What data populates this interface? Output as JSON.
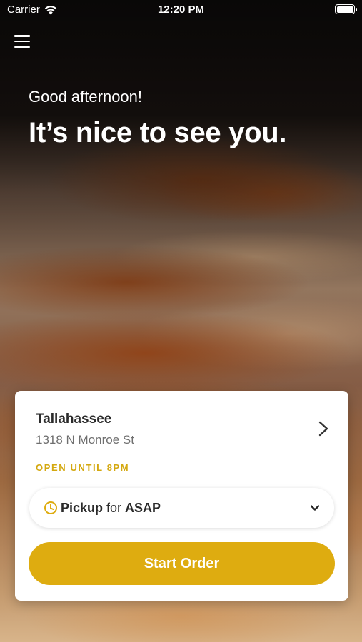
{
  "status_bar": {
    "carrier": "Carrier",
    "time": "12:20 PM"
  },
  "icons": {
    "menu": "hamburger-icon",
    "wifi": "wifi-icon",
    "battery": "battery-icon",
    "chevron_right": "chevron-right-icon",
    "clock": "clock-icon",
    "chevron_down": "chevron-down-icon"
  },
  "hero": {
    "greeting": "Good afternoon!",
    "headline": "It’s nice to see you."
  },
  "location": {
    "name": "Tallahassee",
    "address": "1318 N Monroe St",
    "hours": "OPEN UNTIL 8PM"
  },
  "order_mode": {
    "mode": "Pickup",
    "connector": " for ",
    "time": "ASAP"
  },
  "start_button_label": "Start Order",
  "colors": {
    "accent": "#deac10",
    "hours_text": "#d4a80f",
    "card_bg": "#ffffff"
  },
  "battery_level": 1.0
}
